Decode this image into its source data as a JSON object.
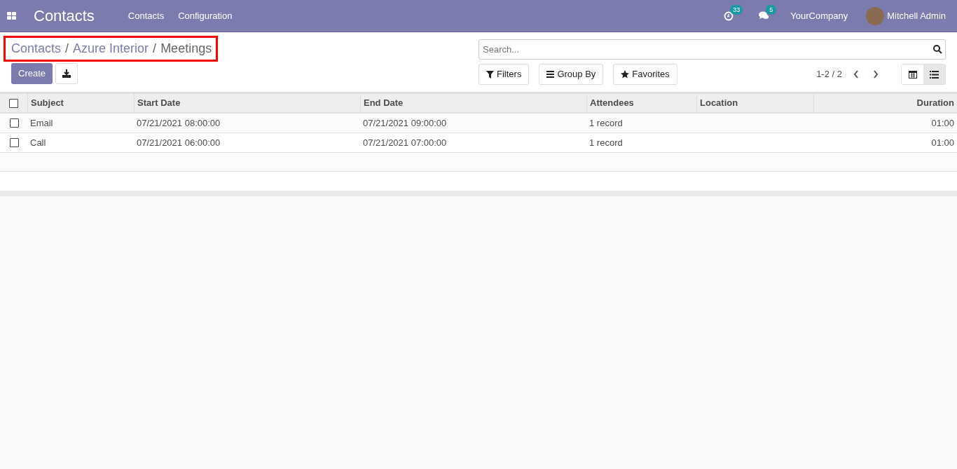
{
  "navbar": {
    "app_title": "Contacts",
    "menu": [
      "Contacts",
      "Configuration"
    ],
    "activity_count": "33",
    "message_count": "5",
    "company": "YourCompany",
    "user": "Mitchell Admin"
  },
  "breadcrumb_separator": "/",
  "breadcrumb": [
    {
      "label": "Contacts",
      "current": false
    },
    {
      "label": "Azure Interior",
      "current": false
    },
    {
      "label": "Meetings",
      "current": true
    }
  ],
  "buttons": {
    "create": "Create"
  },
  "search": {
    "placeholder": "Search..."
  },
  "filters": [
    "Filters",
    "Group By",
    "Favorites"
  ],
  "pager": "1-2 / 2",
  "views": [
    {
      "kind": "calendar",
      "selected": false
    },
    {
      "kind": "list",
      "selected": true
    }
  ],
  "table": {
    "select_all_checked": false,
    "columns": [
      {
        "label": "Subject",
        "kind": "text"
      },
      {
        "label": "Start Date",
        "kind": "text"
      },
      {
        "label": "End Date",
        "kind": "text"
      },
      {
        "label": "Attendees",
        "kind": "text"
      },
      {
        "label": "Location",
        "kind": "text"
      },
      {
        "label": "Duration",
        "kind": "number"
      }
    ],
    "rows": [
      {
        "checked": false,
        "cells": [
          "Email",
          "07/21/2021 08:00:00",
          "07/21/2021 09:00:00",
          "1 record",
          "",
          "01:00"
        ]
      },
      {
        "checked": false,
        "cells": [
          "Call",
          "07/21/2021 06:00:00",
          "07/21/2021 07:00:00",
          "1 record",
          "",
          "01:00"
        ]
      }
    ]
  }
}
